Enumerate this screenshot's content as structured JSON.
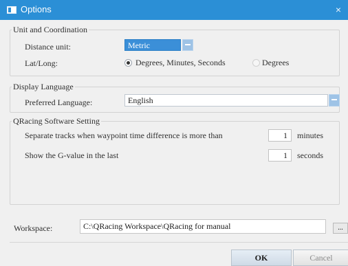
{
  "window": {
    "title": "Options",
    "icon": "window-app-icon",
    "close_glyph": "×"
  },
  "unit_group": {
    "legend": "Unit and Coordination",
    "distance_label": "Distance unit:",
    "distance_value": "Metric",
    "latlong_label": "Lat/Long:",
    "latlong_options": [
      {
        "label": "Degrees, Minutes, Seconds",
        "checked": true
      },
      {
        "label": "Degrees",
        "checked": false
      }
    ]
  },
  "language_group": {
    "legend": "Display Language",
    "preferred_label": "Preferred Language:",
    "preferred_value": "English"
  },
  "software_group": {
    "legend": "QRacing Software Setting",
    "separate_label": "Separate tracks when waypoint time difference is more than",
    "separate_value": "1",
    "separate_unit": "minutes",
    "gvalue_label": "Show the G-value in the last",
    "gvalue_value": "1",
    "gvalue_unit": "seconds"
  },
  "workspace": {
    "label": "Workspace:",
    "path": "C:\\QRacing Workspace\\QRacing  for manual",
    "browse_label": "..."
  },
  "buttons": {
    "ok": "OK",
    "cancel": "Cancel"
  },
  "colors": {
    "titlebar": "#2b8fd6",
    "selection": "#3b8fd8",
    "background": "#f0f0f0"
  }
}
